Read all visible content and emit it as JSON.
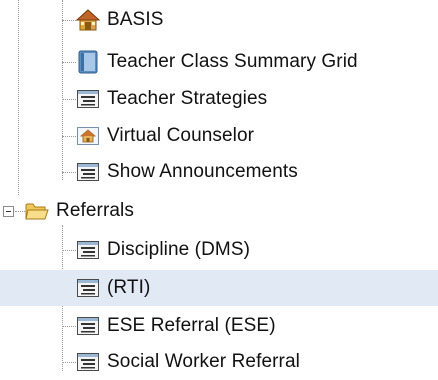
{
  "tree": {
    "items": [
      {
        "label": "BASIS",
        "icon": "home-icon"
      },
      {
        "label": "Teacher Class Summary Grid",
        "icon": "book-icon"
      },
      {
        "label": "Teacher Strategies",
        "icon": "page-icon"
      },
      {
        "label": "Virtual Counselor",
        "icon": "home-small-icon"
      },
      {
        "label": "Show Announcements",
        "icon": "page-icon"
      }
    ],
    "folder": {
      "label": "Referrals",
      "icon": "folder-open-icon",
      "expanded": true
    },
    "children": [
      {
        "label": "Discipline (DMS)",
        "icon": "page-icon"
      },
      {
        "label": "(RTI)",
        "icon": "page-icon",
        "selected": true
      },
      {
        "label": "ESE Referral (ESE)",
        "icon": "page-icon"
      },
      {
        "label": "Social Worker Referral",
        "icon": "page-icon"
      }
    ]
  },
  "colors": {
    "selection": "#e1e9f5",
    "connector": "#9a9a9a",
    "folder": "#f5d36b",
    "book": "#5b8fc4"
  }
}
